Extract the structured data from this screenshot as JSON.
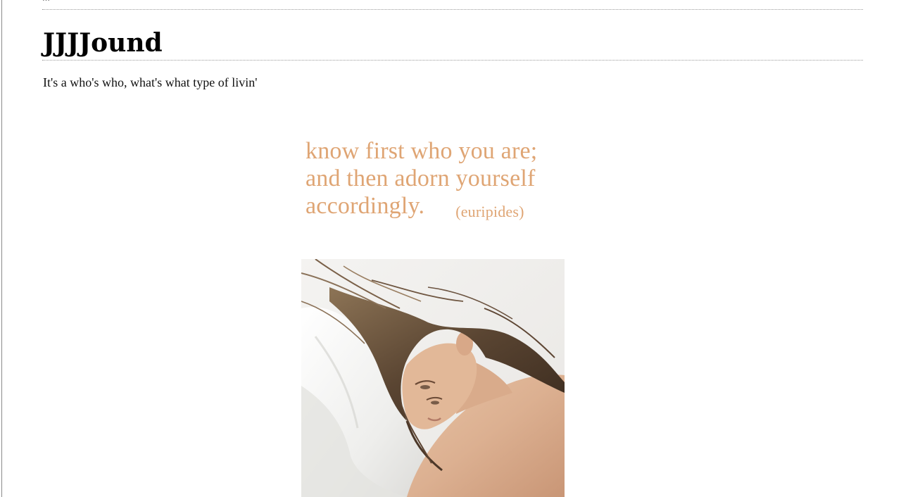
{
  "header": {
    "site_title": "JJJJound",
    "tagline": "It's a who's who, what's what type of livin'"
  },
  "post": {
    "quote_lines": [
      "know first who you are;",
      "and then adorn yourself",
      "accordingly."
    ],
    "quote_author": "(euripides)"
  },
  "colors": {
    "quote_text": "#dfa574",
    "rule": "#9a9a9a"
  }
}
